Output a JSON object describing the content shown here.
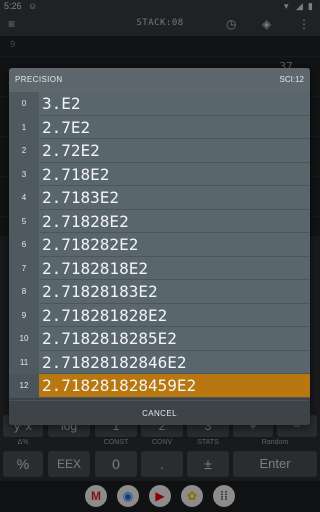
{
  "status": {
    "time": "5:26"
  },
  "toolbar": {
    "title": "STACK:08"
  },
  "stack": {
    "index_label": "9",
    "partial_value": "37 ."
  },
  "keyboard": {
    "row1": [
      "y^x",
      "log",
      "1",
      "2",
      "3",
      "+",
      "−"
    ],
    "row1_labels": [
      "Δ%",
      "",
      "CONST",
      "CONV",
      "STATS",
      "",
      "Random"
    ],
    "row2": [
      "%",
      "EEX",
      "0",
      ".",
      "±",
      "Enter"
    ]
  },
  "dialog": {
    "title": "PRECISION",
    "mode": "SCI:12",
    "selected_index": 12,
    "rows": [
      {
        "num": "0",
        "value": "3.E2"
      },
      {
        "num": "1",
        "value": "2.7E2"
      },
      {
        "num": "2",
        "value": "2.72E2"
      },
      {
        "num": "3",
        "value": "2.718E2"
      },
      {
        "num": "4",
        "value": "2.7183E2"
      },
      {
        "num": "5",
        "value": "2.71828E2"
      },
      {
        "num": "6",
        "value": "2.718282E2"
      },
      {
        "num": "7",
        "value": "2.7182818E2"
      },
      {
        "num": "8",
        "value": "2.71828183E2"
      },
      {
        "num": "9",
        "value": "2.718281828E2"
      },
      {
        "num": "10",
        "value": "2.7182818285E2"
      },
      {
        "num": "11",
        "value": "2.71828182846E2"
      },
      {
        "num": "12",
        "value": "2.718281828459E2"
      }
    ],
    "cancel_label": "CANCEL"
  },
  "colors": {
    "selected": "#b9770f",
    "header": "#5d676c",
    "row": "#59666d"
  },
  "dock": {
    "apps": [
      "gmail-icon",
      "chrome-icon",
      "youtube-icon",
      "photos-icon",
      "apps-icon"
    ]
  }
}
